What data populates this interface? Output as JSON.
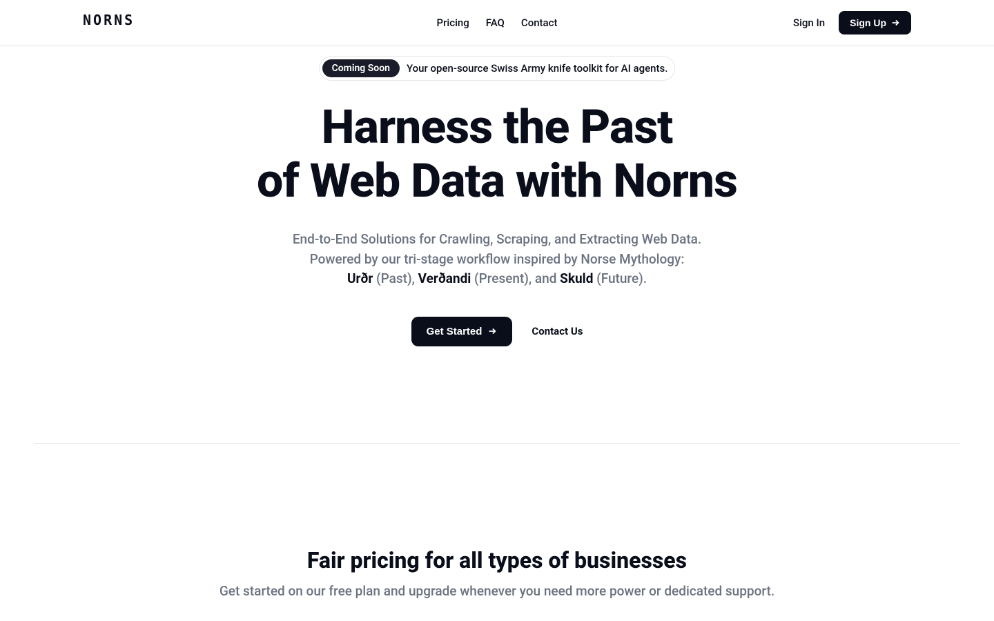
{
  "header": {
    "logo": "NORNS",
    "nav": {
      "pricing": "Pricing",
      "faq": "FAQ",
      "contact": "Contact"
    },
    "signin": "Sign In",
    "signup": "Sign Up"
  },
  "hero": {
    "badge": "Coming Soon",
    "announcement": "Your open-source Swiss Army knife toolkit for AI agents.",
    "title_line1": "Harness the Past",
    "title_line2": "of Web Data with Norns",
    "subtitle_line1": "End-to-End Solutions for Crawling, Scraping, and Extracting Web Data.",
    "subtitle_line2": "Powered by our tri-stage workflow inspired by Norse Mythology:",
    "mythology": {
      "urdr": "Urðr",
      "urdr_desc": " (Past), ",
      "verdandi": "Verðandi",
      "verdandi_desc": " (Present), and ",
      "skuld": "Skuld",
      "skuld_desc": " (Future)."
    },
    "cta_primary": "Get Started",
    "cta_secondary": "Contact Us"
  },
  "pricing": {
    "title": "Fair pricing for all types of businesses",
    "subtitle": "Get started on our free plan and upgrade whenever you need more power or dedicated support."
  }
}
